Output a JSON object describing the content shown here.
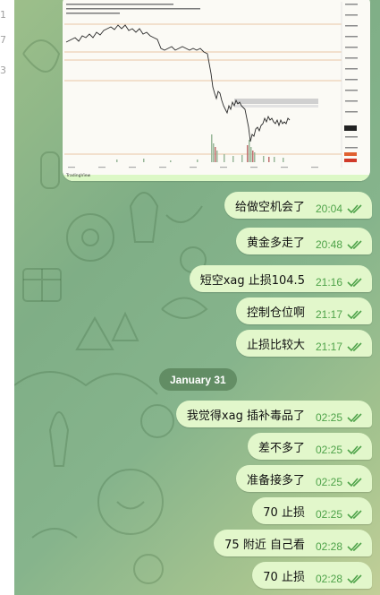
{
  "sidebar_edge": {
    "fragments": [
      "1",
      "7",
      "3"
    ]
  },
  "chart_snapshot": {
    "watermark": "TradingView"
  },
  "date_separator": "January 31",
  "messages": [
    {
      "text": "给做空机会了",
      "time": "20:04"
    },
    {
      "text": "黄金多走了",
      "time": "20:48"
    },
    {
      "text": "短空xag 止损104.5",
      "time": "21:16"
    },
    {
      "text": "控制仓位啊",
      "time": "21:17"
    },
    {
      "text": "止损比较大",
      "time": "21:17"
    },
    {
      "text": "我觉得xag 插补毒品了",
      "time": "02:25"
    },
    {
      "text": "差不多了",
      "time": "02:25"
    },
    {
      "text": "准备接多了",
      "time": "02:25"
    },
    {
      "text": "70 止损",
      "time": "02:25"
    },
    {
      "text": "75 附近 自己看",
      "time": "02:28"
    },
    {
      "text": "70 止损",
      "time": "02:28"
    }
  ],
  "colors": {
    "bubble": "#e2f7cb",
    "time": "#4fa34a",
    "check": "#4fa34a"
  },
  "icons": {
    "read_receipt": "double-check-icon"
  }
}
